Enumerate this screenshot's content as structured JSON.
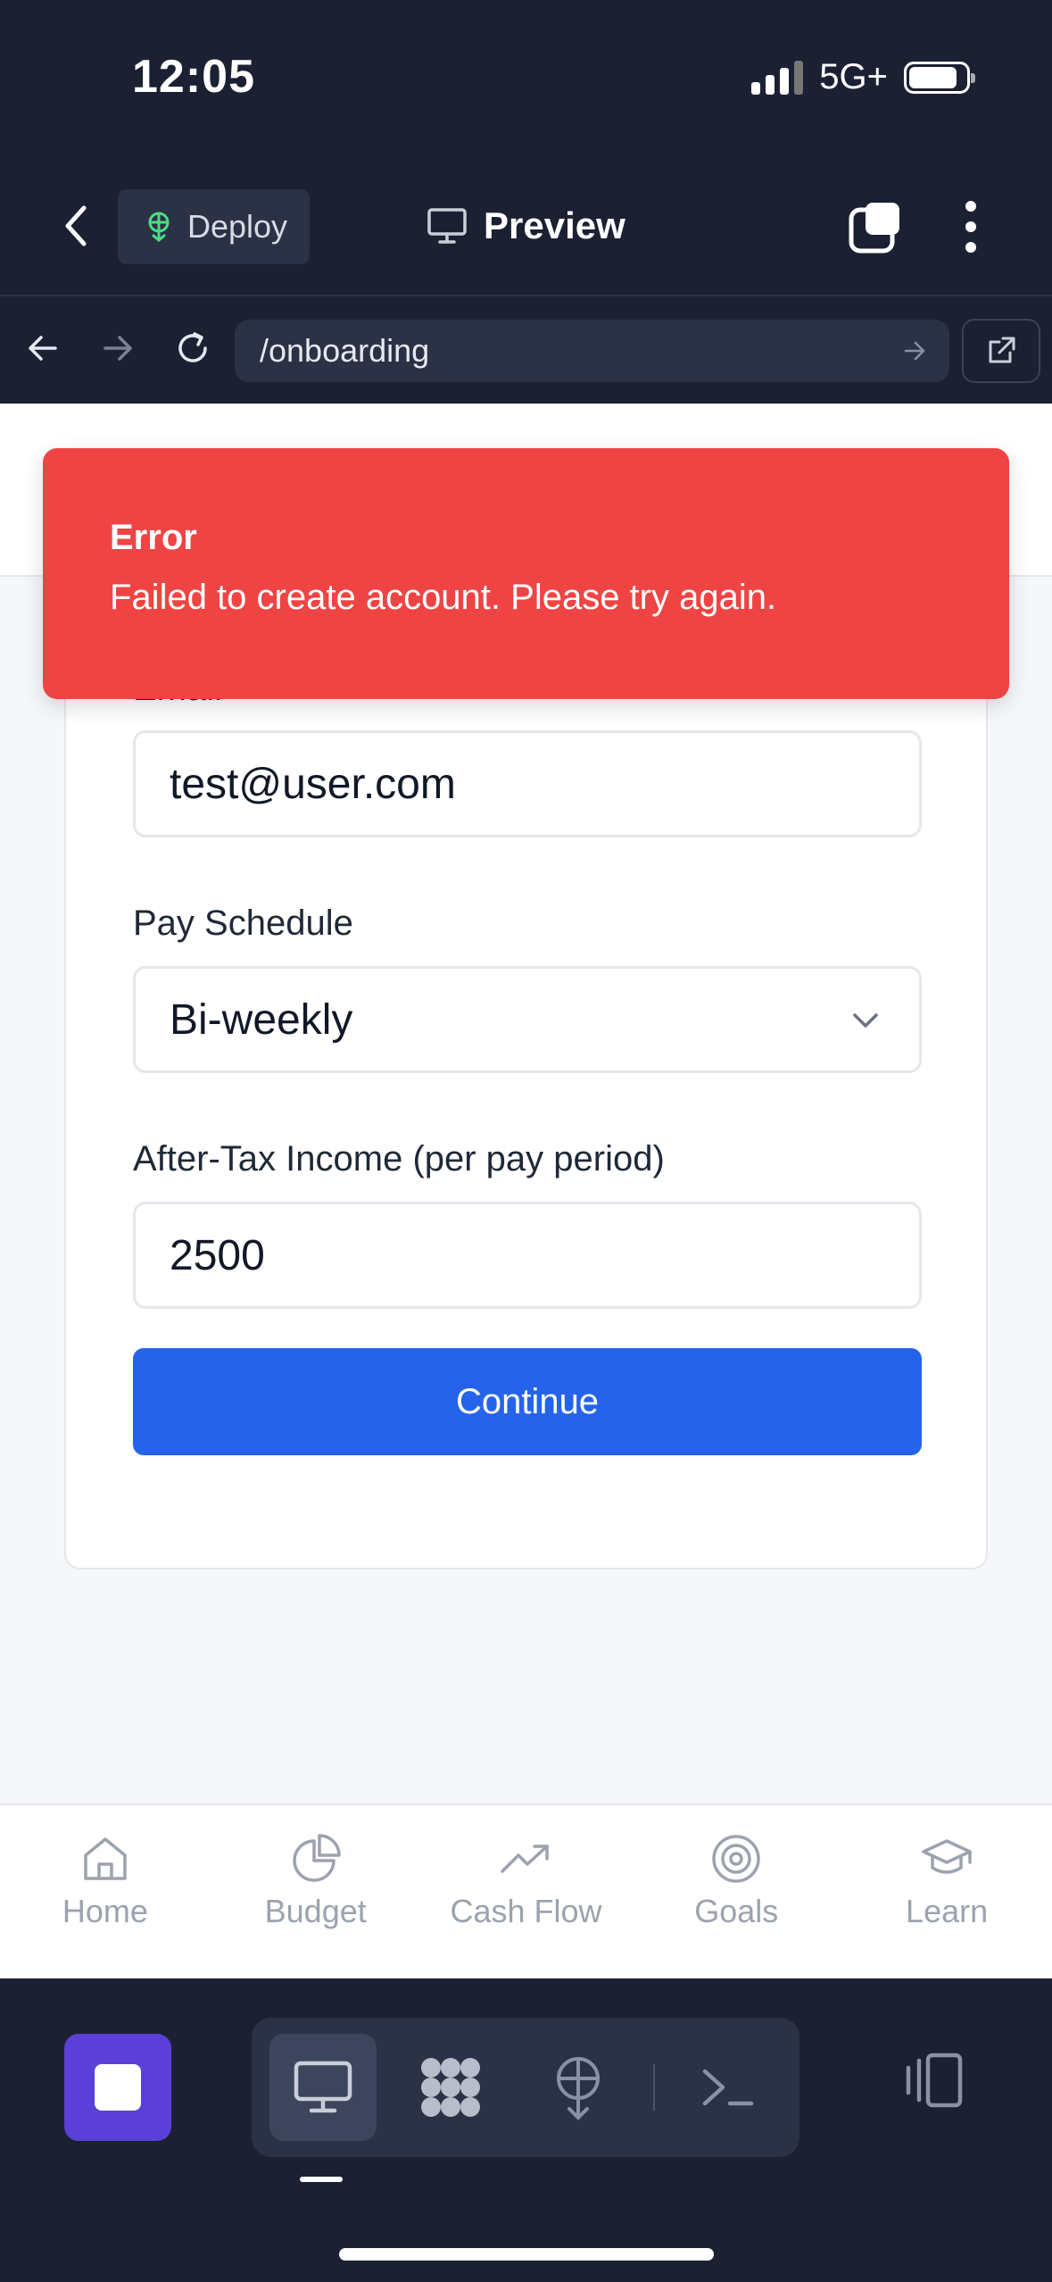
{
  "status_bar": {
    "time": "12:05",
    "network": "5G+"
  },
  "toolbar": {
    "deploy_label": "Deploy",
    "preview_label": "Preview"
  },
  "browser": {
    "url": "/onboarding"
  },
  "toast": {
    "title": "Error",
    "message": "Failed to create account. Please try again."
  },
  "form": {
    "email_label": "Email",
    "email_value": "test@user.com",
    "pay_schedule_label": "Pay Schedule",
    "pay_schedule_value": "Bi-weekly",
    "income_label": "After-Tax Income (per pay period)",
    "income_value": "2500",
    "continue_label": "Continue"
  },
  "bottom_nav": {
    "items": [
      {
        "label": "Home",
        "icon": "home-icon"
      },
      {
        "label": "Budget",
        "icon": "pie-chart-icon"
      },
      {
        "label": "Cash Flow",
        "icon": "trending-up-icon"
      },
      {
        "label": "Goals",
        "icon": "target-icon"
      },
      {
        "label": "Learn",
        "icon": "graduation-cap-icon"
      }
    ]
  },
  "colors": {
    "accent": "#2563eb",
    "error": "#ef4444",
    "dark": "#1b2133",
    "stop": "#5b3fd9"
  }
}
